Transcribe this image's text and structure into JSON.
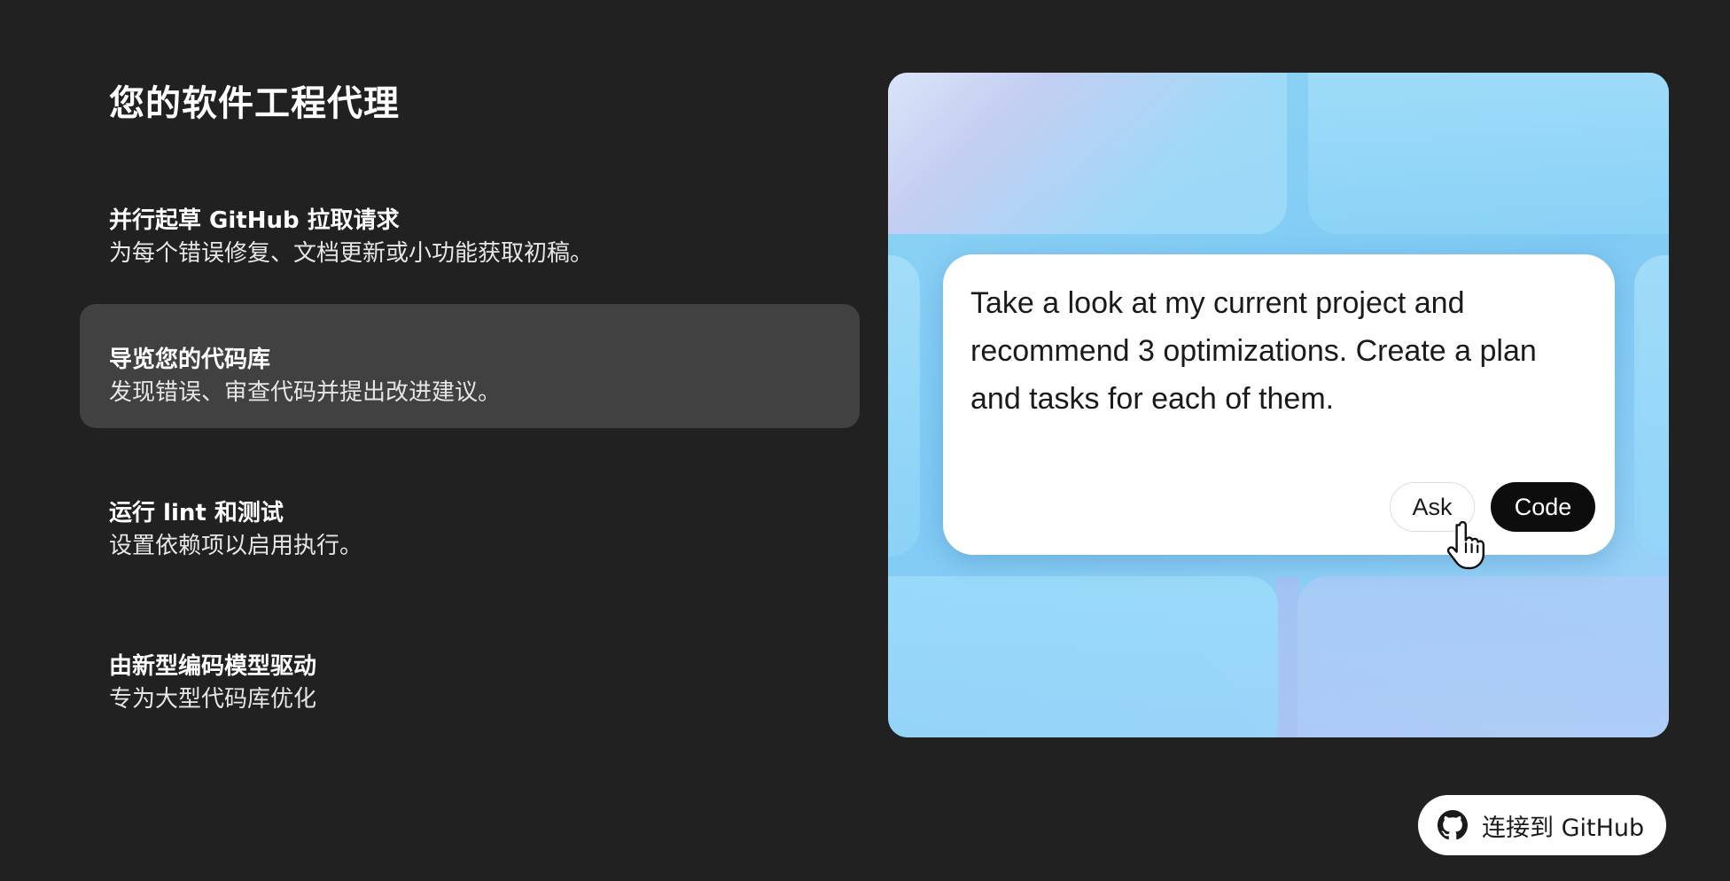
{
  "page": {
    "title": "您的软件工程代理"
  },
  "features": [
    {
      "title": "并行起草 GitHub 拉取请求",
      "description": "为每个错误修复、文档更新或小功能获取初稿。",
      "active": false
    },
    {
      "title": "导览您的代码库",
      "description": "发现错误、审查代码并提出改进建议。",
      "active": true
    },
    {
      "title": "运行 lint 和测试",
      "description": "设置依赖项以启用执行。",
      "active": false
    },
    {
      "title": "由新型编码模型驱动",
      "description": "专为大型代码库优化",
      "active": false
    }
  ],
  "preview": {
    "prompt_text": "Take a look at my current project and recommend 3 optimizations. Create a plan and tasks for each of them.",
    "ask_label": "Ask",
    "code_label": "Code",
    "cursor_icon": "hand-pointer-icon"
  },
  "github": {
    "label": "连接到 GitHub",
    "icon": "github-icon"
  },
  "colors": {
    "background": "#212121",
    "active_item": "#414141",
    "card_blue": "#7fcaf4",
    "code_button": "#0d0d0d"
  }
}
